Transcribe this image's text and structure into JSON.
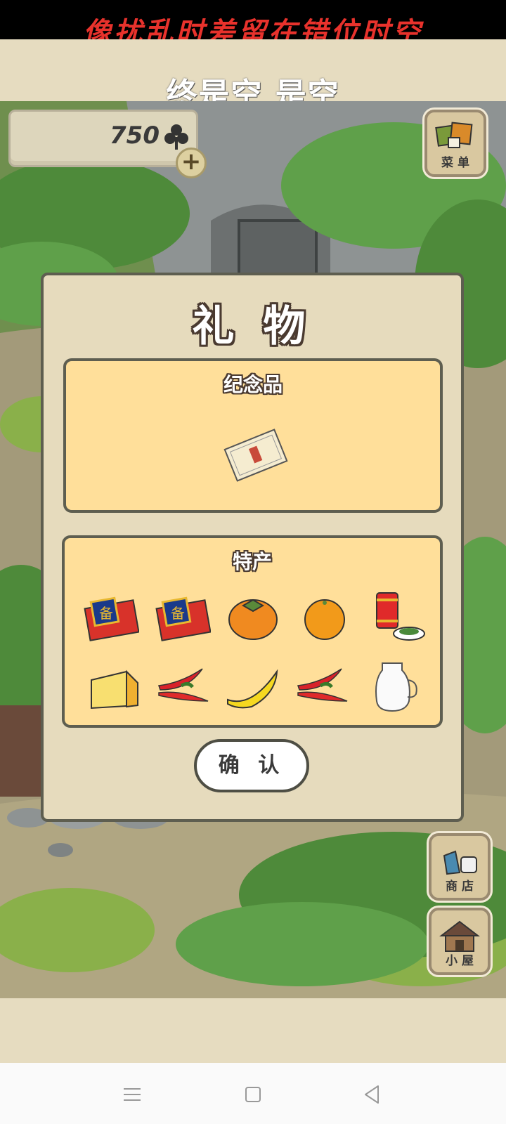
{
  "banner": {
    "line1": "像扰乱时差留在错位时空",
    "line2": "终是空 是空"
  },
  "hud": {
    "clover_count": "750",
    "currency_icon": "clover-icon",
    "plus_icon": "plus-icon"
  },
  "side_buttons": {
    "menu": "菜 单",
    "shop": "商 店",
    "house": "小 屋"
  },
  "gift_dialog": {
    "title": "礼 物",
    "souvenir_section": {
      "title": "纪念品",
      "items": [
        "souvenir-card"
      ]
    },
    "specialty_section": {
      "title": "特产",
      "items": [
        "gift-box-1",
        "gift-box-2",
        "persimmon",
        "orange",
        "tea-can",
        "cheese",
        "chili-peppers-1",
        "banana",
        "chili-peppers-2",
        "milk-jug"
      ]
    },
    "confirm_label": "确 认"
  },
  "navbar": {
    "icons": [
      "menu-icon",
      "home-icon",
      "back-icon"
    ]
  },
  "colors": {
    "panel": "#ffdf9a",
    "dialog": "#e6dbbd",
    "banner_red": "#e8322c",
    "border": "#5e5e50"
  }
}
